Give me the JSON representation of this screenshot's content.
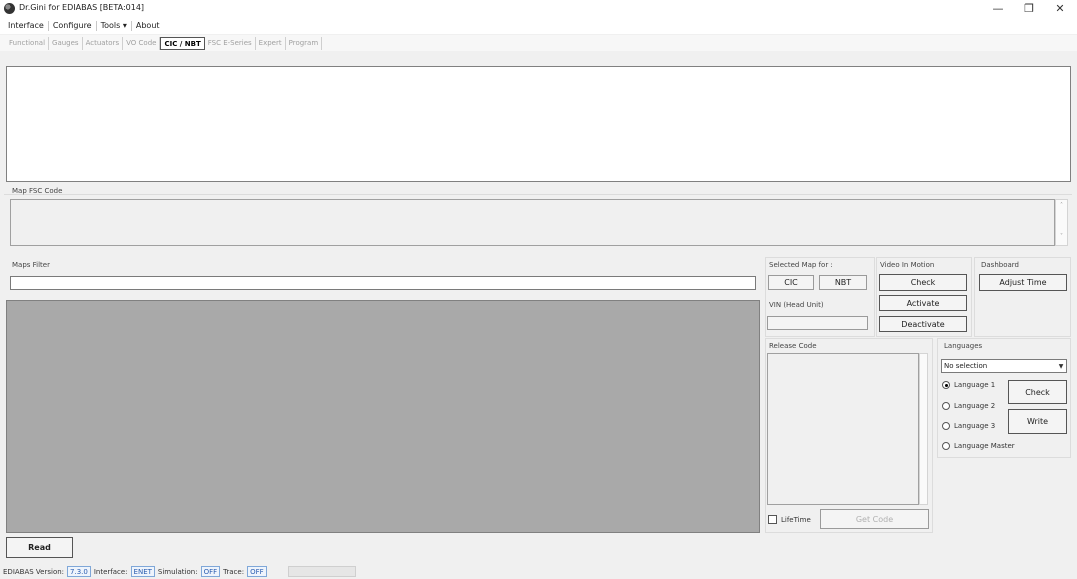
{
  "window": {
    "title": "Dr.Gini for EDIABAS [BETA:014]",
    "minimize_glyph": "—",
    "restore_glyph": "❐",
    "close_glyph": "✕"
  },
  "menu": {
    "items": [
      "Interface",
      "Configure",
      "Tools ▾",
      "About"
    ]
  },
  "tabs": {
    "items": [
      "Functional",
      "Gauges",
      "Actuators",
      "VO Code",
      "CIC / NBT",
      "FSC E-Series",
      "Expert",
      "Program"
    ],
    "active_index": 4
  },
  "map_fsc": {
    "label": "Map FSC Code"
  },
  "maps_filter": {
    "label": "Maps Filter",
    "value": ""
  },
  "selected_map": {
    "label": "Selected Map for :",
    "cic_button": "CIC",
    "nbt_button": "NBT"
  },
  "vin": {
    "label": "VIN (Head Unit)",
    "value": ""
  },
  "video_in_motion": {
    "label": "Video In Motion",
    "check_button": "Check",
    "activate_button": "Activate",
    "deactivate_button": "Deactivate"
  },
  "dashboard": {
    "label": "Dashboard",
    "adjust_time_button": "Adjust Time"
  },
  "release_code": {
    "label": "Release Code",
    "lifetime_label": "LifeTime",
    "lifetime_checked": false,
    "get_code_button": "Get Code"
  },
  "languages": {
    "label": "Languages",
    "selected": "No selection",
    "options": [
      "Language 1",
      "Language 2",
      "Language 3",
      "Language Master"
    ],
    "selected_option_index": 0,
    "check_button": "Check",
    "write_button": "Write"
  },
  "read_button": "Read",
  "status": {
    "ediabas_label": "EDIABAS Version:",
    "ediabas_value": "7.3.0",
    "interface_label": "Interface:",
    "interface_value": "ENET",
    "simulation_label": "Simulation:",
    "simulation_value": "OFF",
    "trace_label": "Trace:",
    "trace_value": "OFF"
  },
  "colors": {
    "window_bg": "#f0f0f0",
    "maps_list_bg": "#a9a9a9",
    "status_value": "#2a5db0"
  }
}
